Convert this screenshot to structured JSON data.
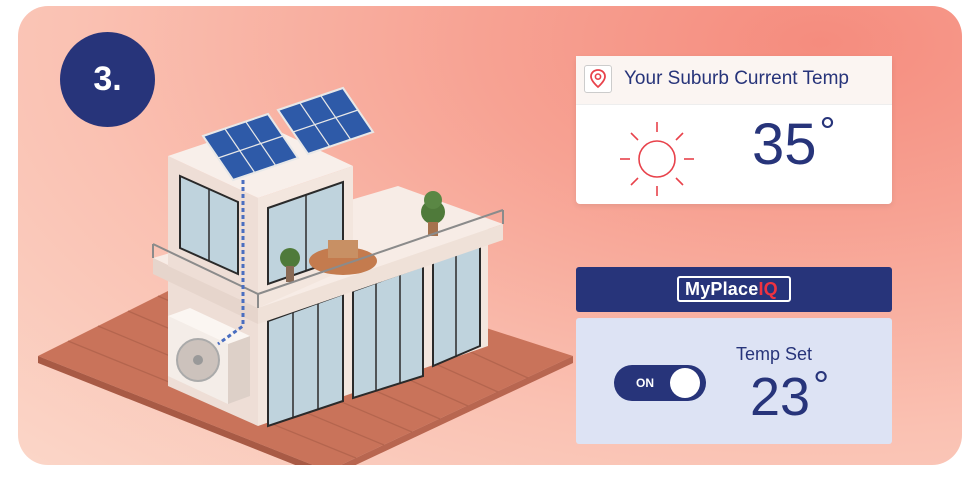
{
  "step": {
    "label": "3."
  },
  "weather": {
    "location_icon": "map-pin-icon",
    "title": "Your Suburb Current Temp",
    "condition_icon": "sun-icon",
    "temp": "35",
    "degree": "°"
  },
  "brand": {
    "name_main": "MyPlace",
    "name_accent": "IQ"
  },
  "control": {
    "toggle_state": "ON",
    "temp_set_label": "Temp Set",
    "set_temp": "23",
    "degree": "°"
  },
  "colors": {
    "navy": "#27347a",
    "accent_red": "#ef3340",
    "sun_red": "#e8424b",
    "control_bg": "#dde3f4"
  }
}
